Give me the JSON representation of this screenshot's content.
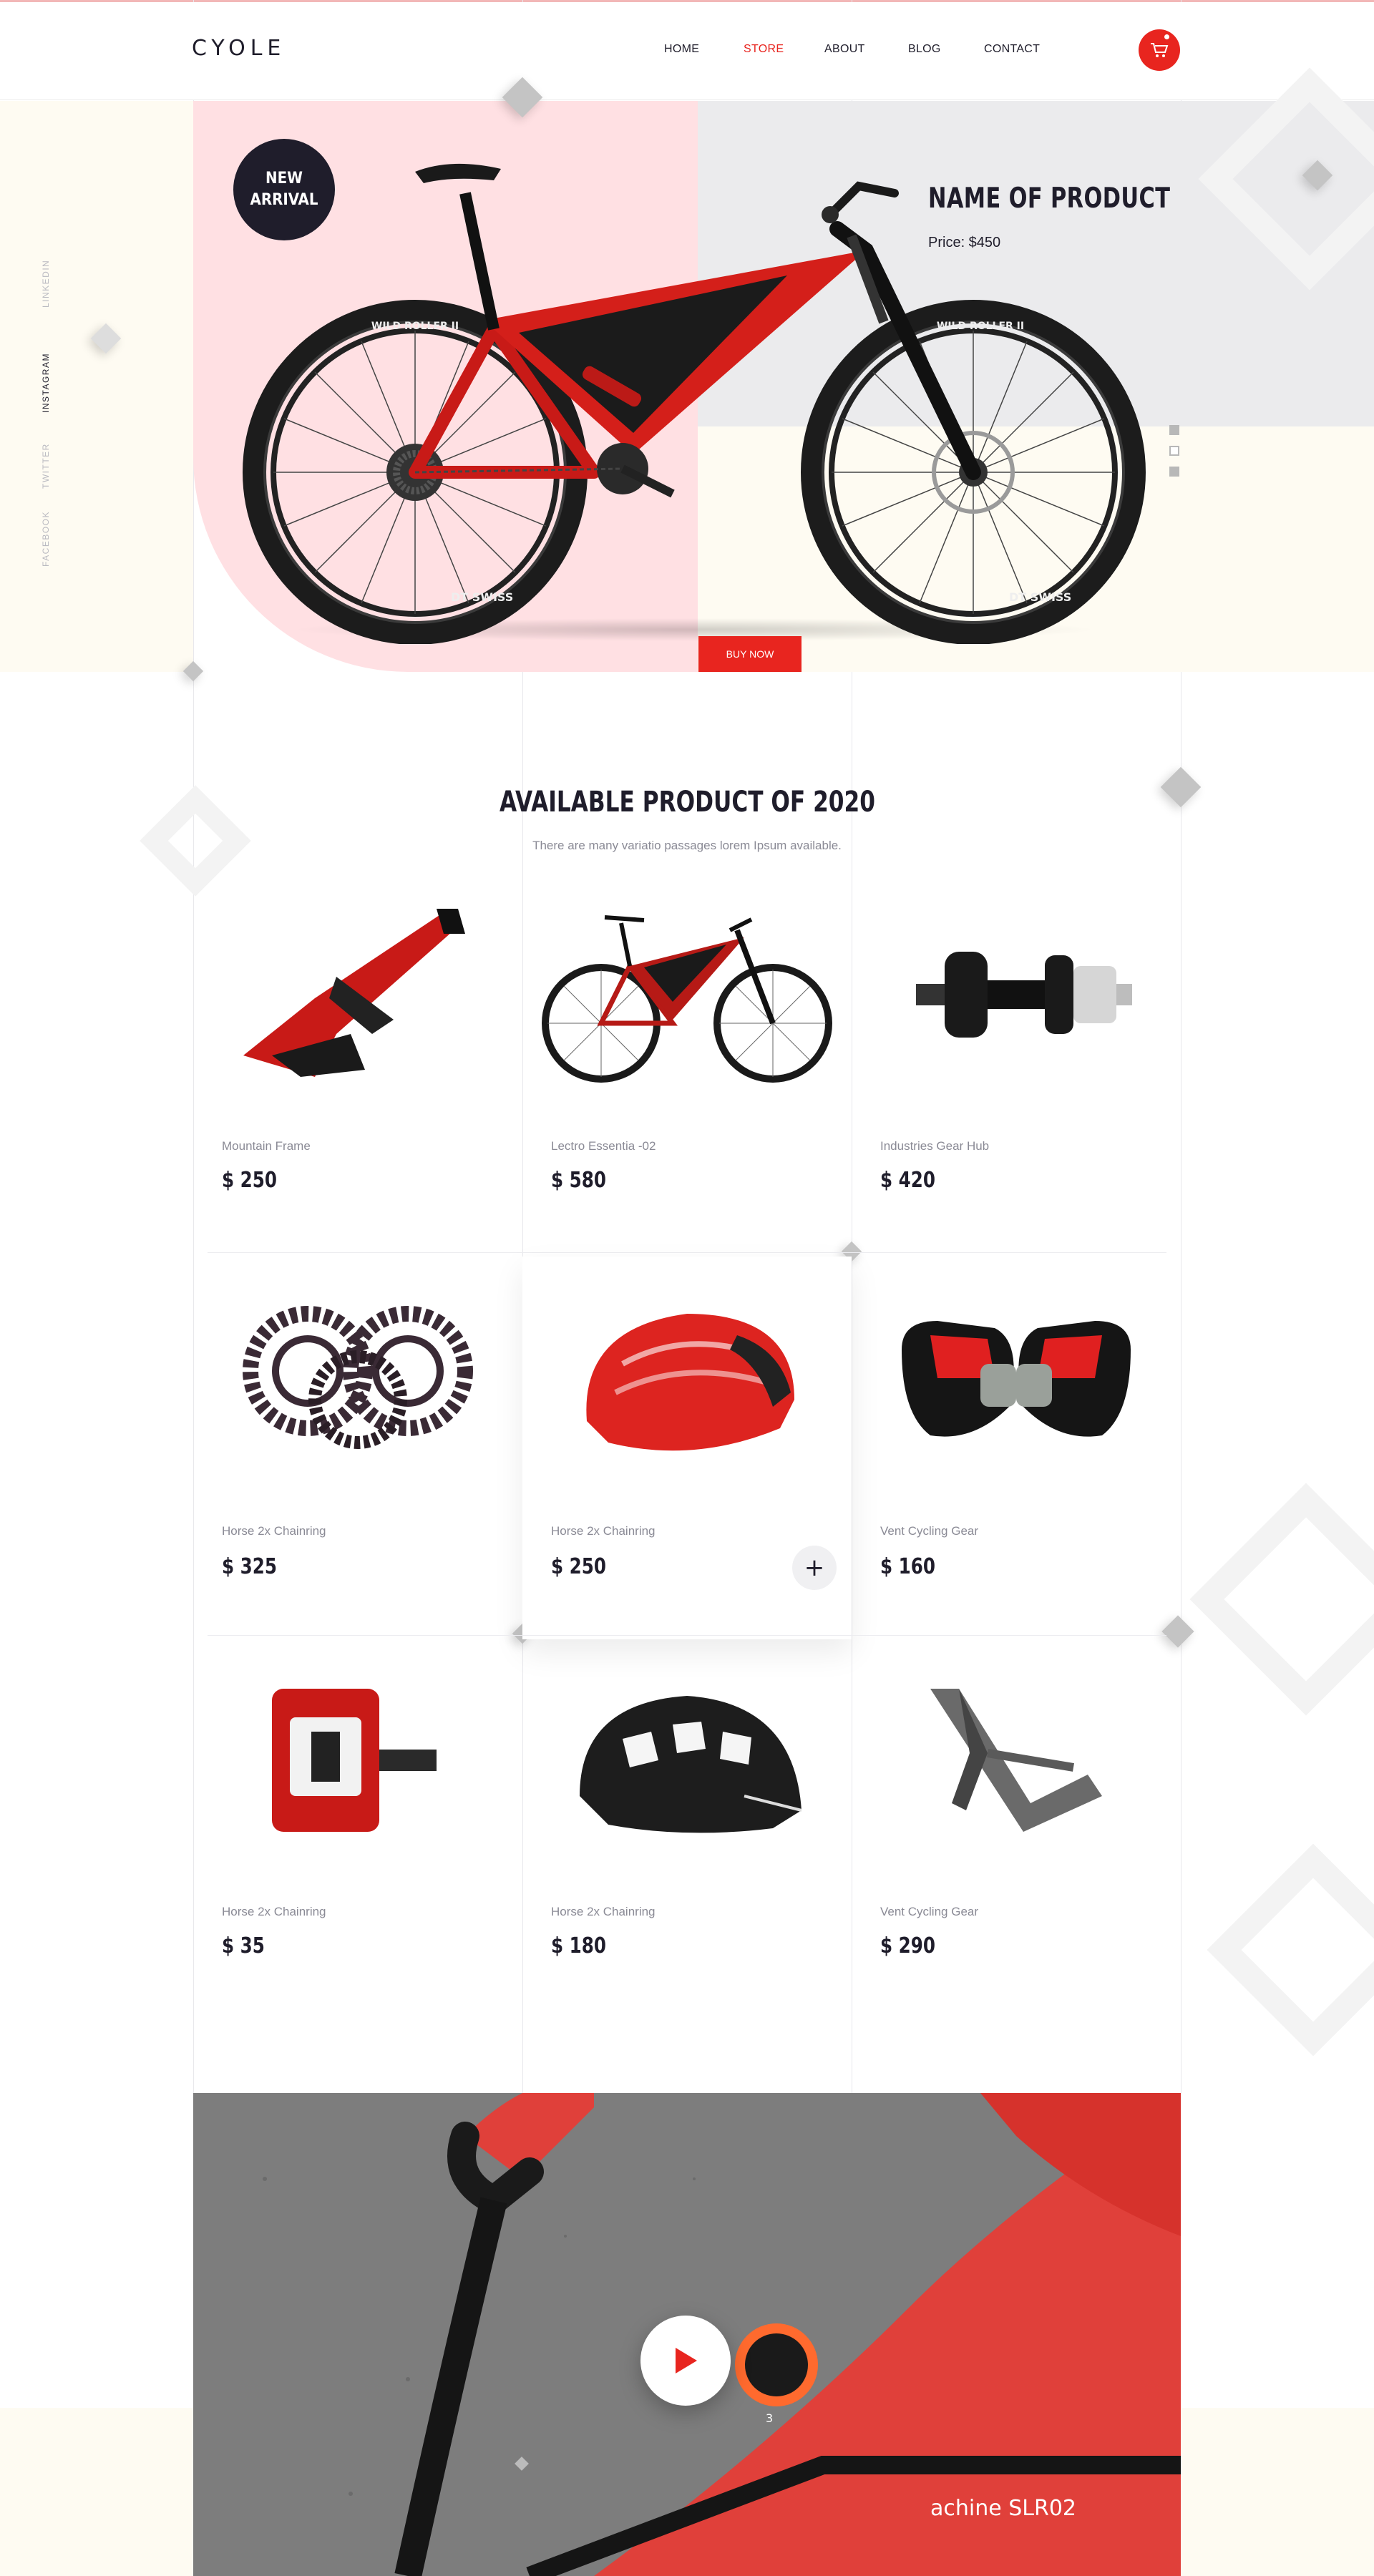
{
  "brand": {
    "logo": "CYOLE"
  },
  "nav": [
    {
      "label": "HOME",
      "active": false
    },
    {
      "label": "STORE",
      "active": true
    },
    {
      "label": "ABOUT",
      "active": false
    },
    {
      "label": "BLOG",
      "active": false
    },
    {
      "label": "CONTACT",
      "active": false
    }
  ],
  "cart": {
    "icon": "cart-icon"
  },
  "social": [
    {
      "label": "LINKEDIN",
      "active": false
    },
    {
      "label": "INSTAGRAM",
      "active": true
    },
    {
      "label": "TWITTER",
      "active": false
    },
    {
      "label": "FACEBOOK",
      "active": false
    }
  ],
  "hero": {
    "badge_line1": "NEW",
    "badge_line2": "ARRIVAL",
    "product_name": "NAME OF PRODUCT",
    "price": "Price: $450",
    "buy_label": "BUY NOW",
    "slider_active_index": 1,
    "slider_count": 3,
    "tire_brand": "WILD ROLLER II",
    "rim_brand": "DT SWISS"
  },
  "products_section": {
    "title": "AVAILABLE PRODUCT OF 2020",
    "subtitle": "There are many variatio passages lorem Ipsum available.",
    "items": [
      {
        "name": "Mountain Frame",
        "price": "$ 250",
        "icon": "frame-icon"
      },
      {
        "name": "Lectro Essentia -02",
        "price": "$ 580",
        "icon": "bicycle-icon"
      },
      {
        "name": "Industries Gear Hub",
        "price": "$ 420",
        "icon": "hub-icon"
      },
      {
        "name": "Horse 2x Chainring",
        "price": "$ 325",
        "icon": "chainring-icon"
      },
      {
        "name": "Horse 2x Chainring",
        "price": "$ 250",
        "icon": "helmet-icon"
      },
      {
        "name": "Vent Cycling Gear",
        "price": "$ 160",
        "icon": "gloves-icon"
      },
      {
        "name": "Horse 2x Chainring",
        "price": "$ 35",
        "icon": "pedal-icon"
      },
      {
        "name": "Horse 2x Chainring",
        "price": "$ 180",
        "icon": "helmet-icon"
      },
      {
        "name": "Vent Cycling Gear",
        "price": "$ 290",
        "icon": "frame-icon"
      }
    ],
    "add_label": "+"
  },
  "video": {
    "caption": "achine SLR02",
    "device_number": "3"
  },
  "colors": {
    "accent": "#e8251f",
    "dark": "#1f1d2b",
    "pink": "#ffe0e3",
    "cream": "#fefbf2",
    "gray": "#ebebed"
  }
}
